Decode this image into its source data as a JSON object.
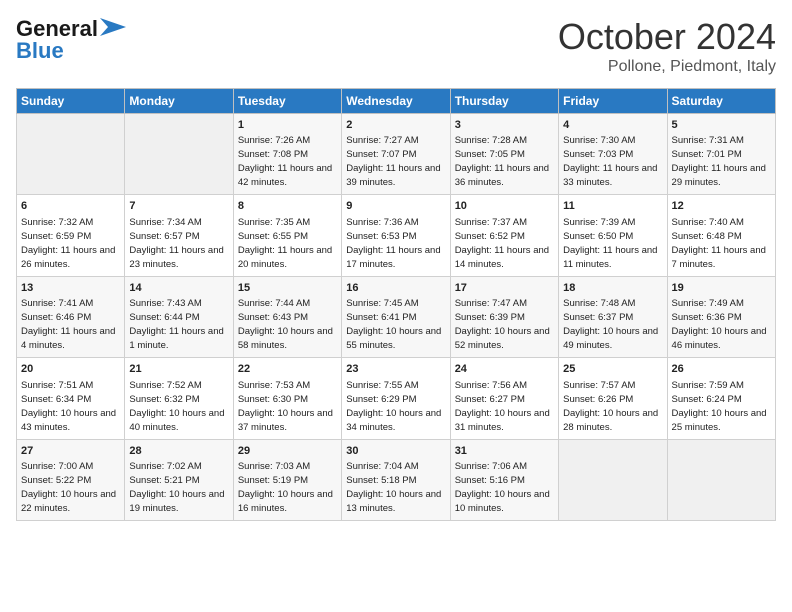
{
  "header": {
    "logo_general": "General",
    "logo_blue": "Blue",
    "title": "October 2024",
    "subtitle": "Pollone, Piedmont, Italy"
  },
  "days_of_week": [
    "Sunday",
    "Monday",
    "Tuesday",
    "Wednesday",
    "Thursday",
    "Friday",
    "Saturday"
  ],
  "weeks": [
    [
      {
        "day": "",
        "sunrise": "",
        "sunset": "",
        "daylight": ""
      },
      {
        "day": "",
        "sunrise": "",
        "sunset": "",
        "daylight": ""
      },
      {
        "day": "1",
        "sunrise": "Sunrise: 7:26 AM",
        "sunset": "Sunset: 7:08 PM",
        "daylight": "Daylight: 11 hours and 42 minutes."
      },
      {
        "day": "2",
        "sunrise": "Sunrise: 7:27 AM",
        "sunset": "Sunset: 7:07 PM",
        "daylight": "Daylight: 11 hours and 39 minutes."
      },
      {
        "day": "3",
        "sunrise": "Sunrise: 7:28 AM",
        "sunset": "Sunset: 7:05 PM",
        "daylight": "Daylight: 11 hours and 36 minutes."
      },
      {
        "day": "4",
        "sunrise": "Sunrise: 7:30 AM",
        "sunset": "Sunset: 7:03 PM",
        "daylight": "Daylight: 11 hours and 33 minutes."
      },
      {
        "day": "5",
        "sunrise": "Sunrise: 7:31 AM",
        "sunset": "Sunset: 7:01 PM",
        "daylight": "Daylight: 11 hours and 29 minutes."
      }
    ],
    [
      {
        "day": "6",
        "sunrise": "Sunrise: 7:32 AM",
        "sunset": "Sunset: 6:59 PM",
        "daylight": "Daylight: 11 hours and 26 minutes."
      },
      {
        "day": "7",
        "sunrise": "Sunrise: 7:34 AM",
        "sunset": "Sunset: 6:57 PM",
        "daylight": "Daylight: 11 hours and 23 minutes."
      },
      {
        "day": "8",
        "sunrise": "Sunrise: 7:35 AM",
        "sunset": "Sunset: 6:55 PM",
        "daylight": "Daylight: 11 hours and 20 minutes."
      },
      {
        "day": "9",
        "sunrise": "Sunrise: 7:36 AM",
        "sunset": "Sunset: 6:53 PM",
        "daylight": "Daylight: 11 hours and 17 minutes."
      },
      {
        "day": "10",
        "sunrise": "Sunrise: 7:37 AM",
        "sunset": "Sunset: 6:52 PM",
        "daylight": "Daylight: 11 hours and 14 minutes."
      },
      {
        "day": "11",
        "sunrise": "Sunrise: 7:39 AM",
        "sunset": "Sunset: 6:50 PM",
        "daylight": "Daylight: 11 hours and 11 minutes."
      },
      {
        "day": "12",
        "sunrise": "Sunrise: 7:40 AM",
        "sunset": "Sunset: 6:48 PM",
        "daylight": "Daylight: 11 hours and 7 minutes."
      }
    ],
    [
      {
        "day": "13",
        "sunrise": "Sunrise: 7:41 AM",
        "sunset": "Sunset: 6:46 PM",
        "daylight": "Daylight: 11 hours and 4 minutes."
      },
      {
        "day": "14",
        "sunrise": "Sunrise: 7:43 AM",
        "sunset": "Sunset: 6:44 PM",
        "daylight": "Daylight: 11 hours and 1 minute."
      },
      {
        "day": "15",
        "sunrise": "Sunrise: 7:44 AM",
        "sunset": "Sunset: 6:43 PM",
        "daylight": "Daylight: 10 hours and 58 minutes."
      },
      {
        "day": "16",
        "sunrise": "Sunrise: 7:45 AM",
        "sunset": "Sunset: 6:41 PM",
        "daylight": "Daylight: 10 hours and 55 minutes."
      },
      {
        "day": "17",
        "sunrise": "Sunrise: 7:47 AM",
        "sunset": "Sunset: 6:39 PM",
        "daylight": "Daylight: 10 hours and 52 minutes."
      },
      {
        "day": "18",
        "sunrise": "Sunrise: 7:48 AM",
        "sunset": "Sunset: 6:37 PM",
        "daylight": "Daylight: 10 hours and 49 minutes."
      },
      {
        "day": "19",
        "sunrise": "Sunrise: 7:49 AM",
        "sunset": "Sunset: 6:36 PM",
        "daylight": "Daylight: 10 hours and 46 minutes."
      }
    ],
    [
      {
        "day": "20",
        "sunrise": "Sunrise: 7:51 AM",
        "sunset": "Sunset: 6:34 PM",
        "daylight": "Daylight: 10 hours and 43 minutes."
      },
      {
        "day": "21",
        "sunrise": "Sunrise: 7:52 AM",
        "sunset": "Sunset: 6:32 PM",
        "daylight": "Daylight: 10 hours and 40 minutes."
      },
      {
        "day": "22",
        "sunrise": "Sunrise: 7:53 AM",
        "sunset": "Sunset: 6:30 PM",
        "daylight": "Daylight: 10 hours and 37 minutes."
      },
      {
        "day": "23",
        "sunrise": "Sunrise: 7:55 AM",
        "sunset": "Sunset: 6:29 PM",
        "daylight": "Daylight: 10 hours and 34 minutes."
      },
      {
        "day": "24",
        "sunrise": "Sunrise: 7:56 AM",
        "sunset": "Sunset: 6:27 PM",
        "daylight": "Daylight: 10 hours and 31 minutes."
      },
      {
        "day": "25",
        "sunrise": "Sunrise: 7:57 AM",
        "sunset": "Sunset: 6:26 PM",
        "daylight": "Daylight: 10 hours and 28 minutes."
      },
      {
        "day": "26",
        "sunrise": "Sunrise: 7:59 AM",
        "sunset": "Sunset: 6:24 PM",
        "daylight": "Daylight: 10 hours and 25 minutes."
      }
    ],
    [
      {
        "day": "27",
        "sunrise": "Sunrise: 7:00 AM",
        "sunset": "Sunset: 5:22 PM",
        "daylight": "Daylight: 10 hours and 22 minutes."
      },
      {
        "day": "28",
        "sunrise": "Sunrise: 7:02 AM",
        "sunset": "Sunset: 5:21 PM",
        "daylight": "Daylight: 10 hours and 19 minutes."
      },
      {
        "day": "29",
        "sunrise": "Sunrise: 7:03 AM",
        "sunset": "Sunset: 5:19 PM",
        "daylight": "Daylight: 10 hours and 16 minutes."
      },
      {
        "day": "30",
        "sunrise": "Sunrise: 7:04 AM",
        "sunset": "Sunset: 5:18 PM",
        "daylight": "Daylight: 10 hours and 13 minutes."
      },
      {
        "day": "31",
        "sunrise": "Sunrise: 7:06 AM",
        "sunset": "Sunset: 5:16 PM",
        "daylight": "Daylight: 10 hours and 10 minutes."
      },
      {
        "day": "",
        "sunrise": "",
        "sunset": "",
        "daylight": ""
      },
      {
        "day": "",
        "sunrise": "",
        "sunset": "",
        "daylight": ""
      }
    ]
  ]
}
